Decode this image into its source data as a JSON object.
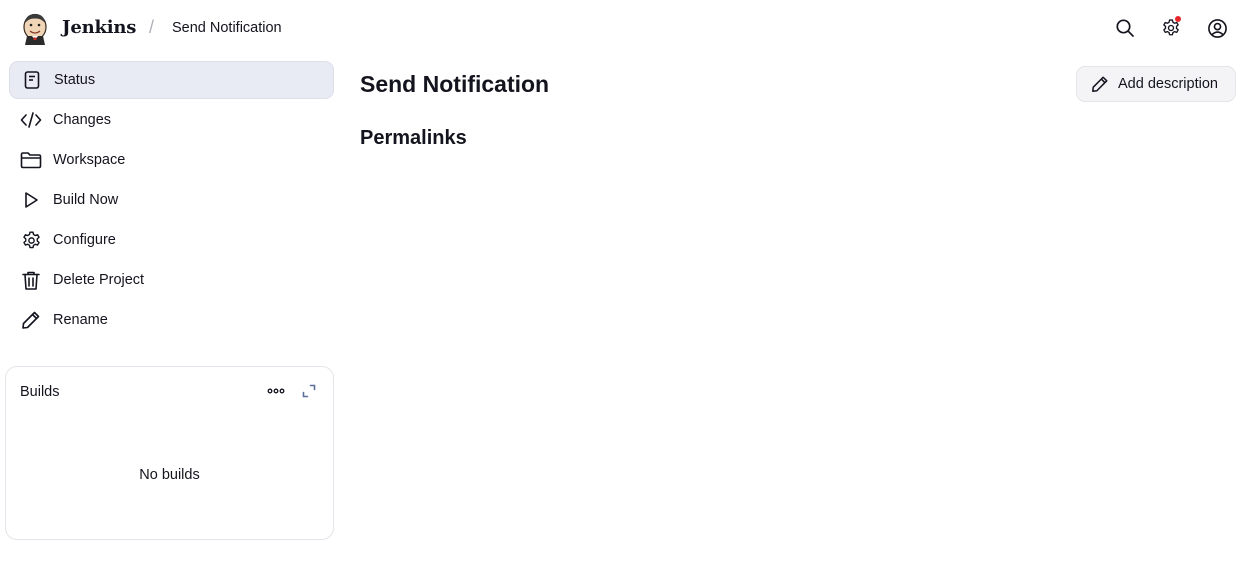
{
  "header": {
    "brand": "Jenkins",
    "separator": "/",
    "breadcrumb": "Send Notification",
    "icons": [
      "search-icon",
      "gear-icon",
      "user-icon"
    ],
    "notification_color": "#e5262b"
  },
  "sidebar": {
    "items": [
      {
        "label": "Status",
        "icon": "document-icon",
        "active": true
      },
      {
        "label": "Changes",
        "icon": "code-icon"
      },
      {
        "label": "Workspace",
        "icon": "folder-icon"
      },
      {
        "label": "Build Now",
        "icon": "play-icon"
      },
      {
        "label": "Configure",
        "icon": "gear-icon"
      },
      {
        "label": "Delete Project",
        "icon": "trash-icon"
      },
      {
        "label": "Rename",
        "icon": "pencil-icon"
      }
    ]
  },
  "builds": {
    "title": "Builds",
    "empty_text": "No builds"
  },
  "main": {
    "title": "Send Notification",
    "add_description": "Add description",
    "permalinks_heading": "Permalinks"
  }
}
